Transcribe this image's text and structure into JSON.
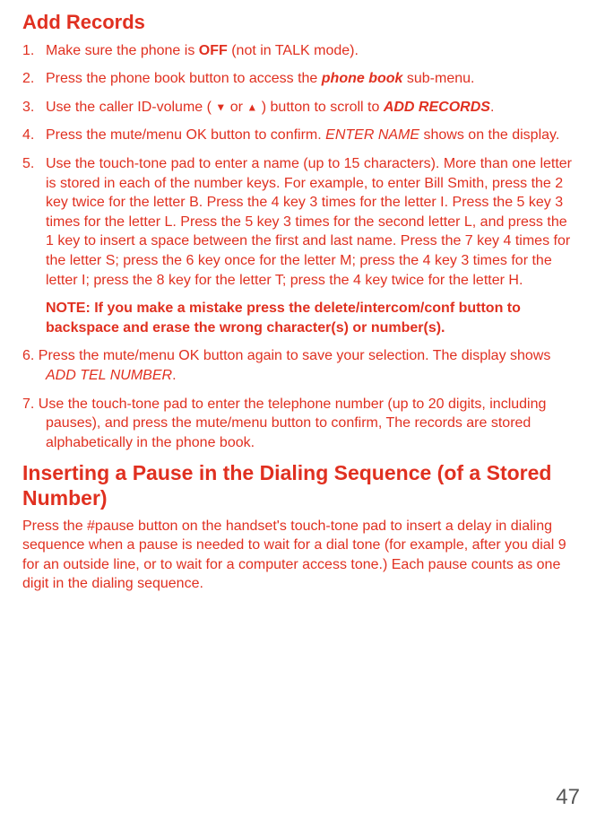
{
  "heading1": "Add Records",
  "step1": {
    "num": "1.",
    "pre": "Make sure the phone is ",
    "bold": "OFF",
    "post": " (not in TALK mode)."
  },
  "step2": {
    "num": "2.",
    "pre": "Press the phone book button to access the ",
    "bolditalic": "phone book",
    "post": " sub-menu."
  },
  "step3": {
    "num": "3.",
    "pre": "Use the caller ID-volume ( ",
    "mid": " or ",
    "post": " ) button to scroll to ",
    "bolditalic": "ADD RECORDS",
    "end": "."
  },
  "step4": {
    "num": "4.",
    "pre": "Press the mute/menu OK button to confirm. ",
    "italic": "ENTER NAME",
    "post": " shows on the display."
  },
  "step5": {
    "num": "5.",
    "text": "Use the touch-tone pad to enter a name (up to 15 characters). More than one letter is stored in each of the number keys. For example, to enter Bill Smith, press the 2 key twice for the letter B. Press the 4 key 3 times for the letter I. Press the 5 key 3 times for the letter L. Press the 5 key 3 times for the second letter L, and press the 1 key to insert a space between the first and last name. Press the 7 key 4 times for the letter S; press the 6 key once for the letter M; press the 4 key 3 times for the letter I; press the 8 key for the letter T; press the 4 key twice for the letter H."
  },
  "note": "NOTE: If you make a mistake press the delete/intercom/conf button to backspace and erase the wrong character(s) or number(s).",
  "step6": {
    "lead": "6. Press the mute/menu OK button again to save your selection. The display shows ",
    "italic": "ADD TEL NUMBER",
    "end": "."
  },
  "step7": {
    "lead": "7. Use the touch-tone pad to enter the telephone number (up to 20 digits, including",
    "rest": "pauses), and press the mute/menu button to confirm, The records are stored alphabetically in the phone book."
  },
  "heading2": "Inserting a Pause in the Dialing Sequence (of a Stored Number)",
  "para2": "Press the #pause button on the handset's touch-tone pad to insert a delay in dialing sequence when a pause is needed to wait for a dial tone (for example, after you dial 9 for an outside line, or to wait for a computer access tone.) Each pause counts as one digit in the dialing sequence.",
  "pageNum": "47"
}
